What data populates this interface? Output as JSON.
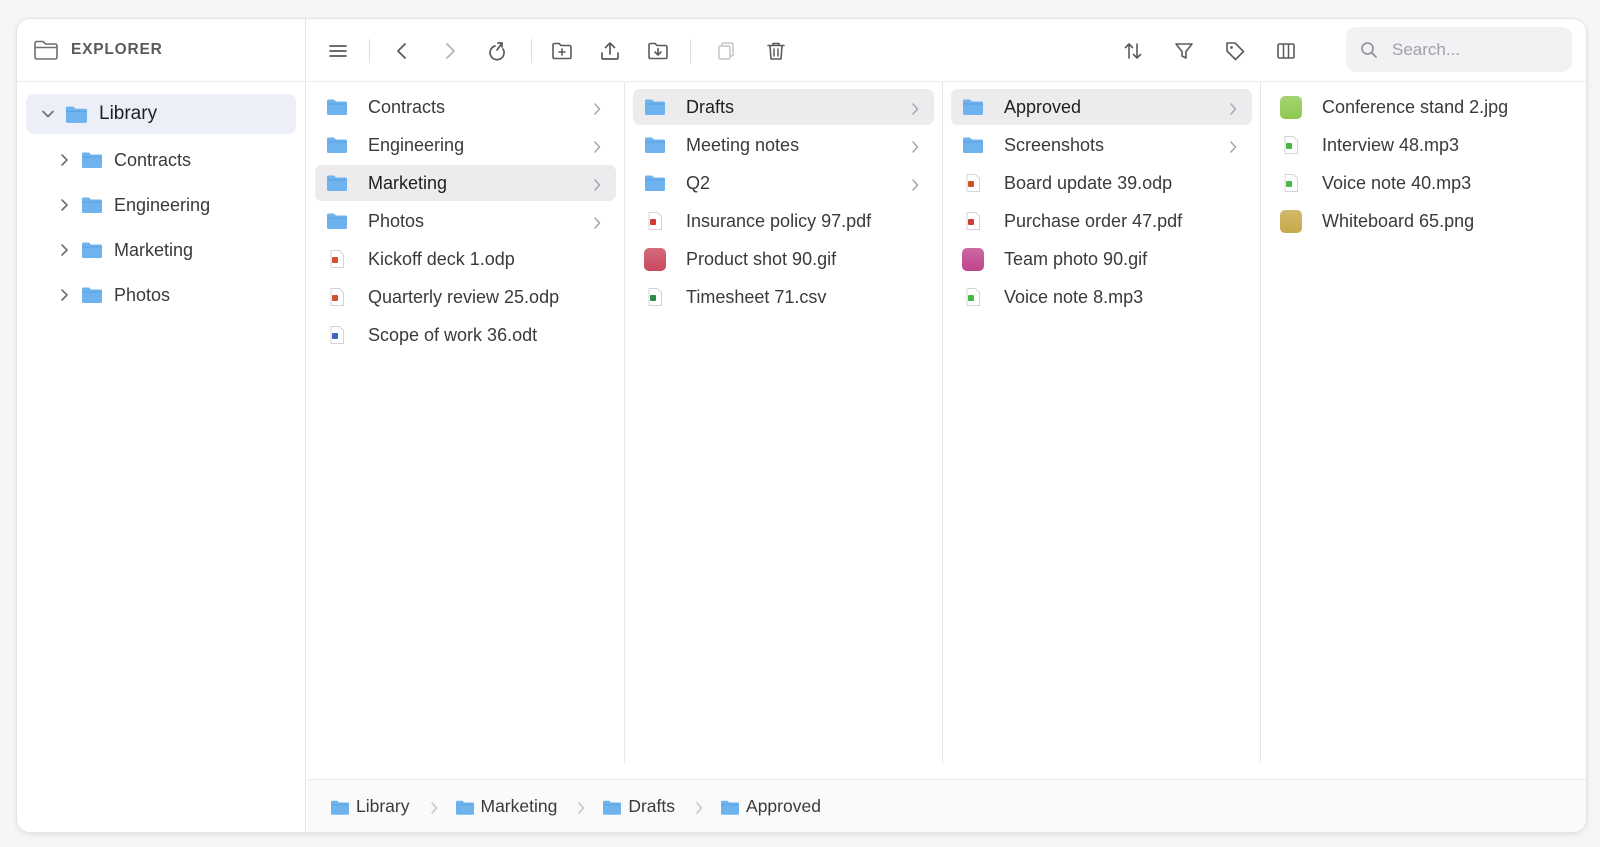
{
  "sidebar": {
    "title": "EXPLORER",
    "root": {
      "label": "Library"
    },
    "items": [
      {
        "label": "Contracts"
      },
      {
        "label": "Engineering"
      },
      {
        "label": "Marketing"
      },
      {
        "label": "Photos"
      }
    ]
  },
  "toolbar": {
    "buttons": [
      "menu-icon",
      "back-icon",
      "forward-icon",
      "refresh-icon",
      "new-folder-icon",
      "upload-icon",
      "download-icon",
      "copy-icon",
      "delete-icon",
      "sort-icon",
      "filter-icon",
      "tag-icon",
      "columns-icon"
    ],
    "search_placeholder": "Search..."
  },
  "columns": [
    {
      "items": [
        {
          "label": "Contracts",
          "type": "folder"
        },
        {
          "label": "Engineering",
          "type": "folder"
        },
        {
          "label": "Marketing",
          "type": "folder",
          "selected": true
        },
        {
          "label": "Photos",
          "type": "folder"
        },
        {
          "label": "Kickoff deck 1.odp",
          "type": "slides"
        },
        {
          "label": "Quarterly review 25.odp",
          "type": "slides"
        },
        {
          "label": "Scope of work 36.odt",
          "type": "doc"
        }
      ]
    },
    {
      "items": [
        {
          "label": "Drafts",
          "type": "folder",
          "selected": true
        },
        {
          "label": "Meeting notes",
          "type": "folder"
        },
        {
          "label": "Q2",
          "type": "folder"
        },
        {
          "label": "Insurance policy 97.pdf",
          "type": "pdf"
        },
        {
          "label": "Product shot 90.gif",
          "type": "image",
          "thumb": "#c9485e"
        },
        {
          "label": "Timesheet 71.csv",
          "type": "sheet"
        }
      ]
    },
    {
      "items": [
        {
          "label": "Approved",
          "type": "folder",
          "selected": true
        },
        {
          "label": "Screenshots",
          "type": "folder"
        },
        {
          "label": "Board update 39.odp",
          "type": "slides"
        },
        {
          "label": "Purchase order 47.pdf",
          "type": "pdf"
        },
        {
          "label": "Team photo 90.gif",
          "type": "image",
          "thumb": "#c0448c"
        },
        {
          "label": "Voice note 8.mp3",
          "type": "audio"
        }
      ]
    },
    {
      "items": [
        {
          "label": "Conference stand 2.jpg",
          "type": "image",
          "thumb": "#8fc850"
        },
        {
          "label": "Interview 48.mp3",
          "type": "audio"
        },
        {
          "label": "Voice note 40.mp3",
          "type": "audio"
        },
        {
          "label": "Whiteboard 65.png",
          "type": "image",
          "thumb": "#c8a84a"
        }
      ]
    }
  ],
  "breadcrumb": [
    "Library",
    "Marketing",
    "Drafts",
    "Approved"
  ],
  "colors": {
    "folder": "#6fb3ee",
    "selected_bg": "#ececee",
    "root_bg": "#eceef8"
  }
}
